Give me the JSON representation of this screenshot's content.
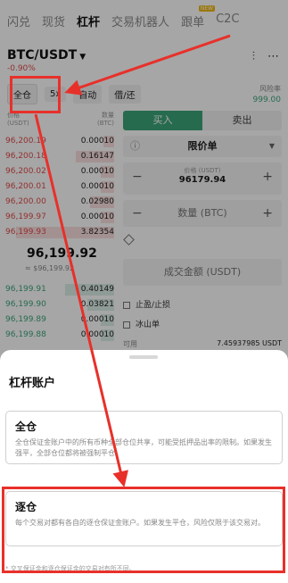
{
  "tabs": [
    {
      "label": "闪兑"
    },
    {
      "label": "现货"
    },
    {
      "label": "杠杆"
    },
    {
      "label": "交易机器人"
    },
    {
      "label": "跟单",
      "badge": "NEW"
    },
    {
      "label": "C2C"
    }
  ],
  "pair": {
    "name": "BTC/USDT",
    "change": "-0.90%"
  },
  "mode": {
    "margin": "全仓",
    "leverage": "5x",
    "auto": "自动",
    "borrow": "借/还"
  },
  "risk": {
    "label": "风险率",
    "value": "999.00"
  },
  "orderbook": {
    "price_header": "价格\n(USDT)",
    "qty_header": "数量\n(BTC)",
    "asks": [
      {
        "price": "96,200.19",
        "qty": "0.00010",
        "depth": 0.1
      },
      {
        "price": "96,200.18",
        "qty": "0.16147",
        "depth": 0.35
      },
      {
        "price": "96,200.02",
        "qty": "0.00010",
        "depth": 0.12
      },
      {
        "price": "96,200.01",
        "qty": "0.00010",
        "depth": 0.12
      },
      {
        "price": "96,200.00",
        "qty": "0.02980",
        "depth": 0.22
      },
      {
        "price": "96,199.97",
        "qty": "0.00010",
        "depth": 0.12
      },
      {
        "price": "96,199.93",
        "qty": "3.82354",
        "depth": 0.9
      }
    ],
    "mid_price": "96,199.92",
    "mid_sub": "≈ $96,199.92",
    "bids": [
      {
        "price": "96,199.91",
        "qty": "0.40149",
        "depth": 0.45
      },
      {
        "price": "96,199.90",
        "qty": "0.03821",
        "depth": 0.25
      },
      {
        "price": "96,199.89",
        "qty": "0.00010",
        "depth": 0.12
      },
      {
        "price": "96,199.88",
        "qty": "0.00010",
        "depth": 0.12
      }
    ]
  },
  "order": {
    "buy": "买入",
    "sell": "卖出",
    "type": "限价单",
    "price_label": "价格 (USDT)",
    "price_value": "96179.94",
    "qty_label": "数量 (BTC)",
    "amount_label": "成交金额 (USDT)",
    "tp_sl": "止盈/止损",
    "iceberg": "冰山单",
    "avail_label": "可用",
    "avail_value": "7.45937985 USDT"
  },
  "sheet": {
    "title": "杠杆账户",
    "cross_title": "全仓",
    "cross_desc": "全仓保证金账户中的所有币种全部仓位共享，可能受抵押品出率的限制。如果发生强平，全部仓位都将被强制平仓。",
    "isolated_title": "逐仓",
    "isolated_desc": "每个交易对都有各自的逐仓保证金账户。如果发生平仓，风险仅限于该交易对。",
    "footnote": "* 交叉保证金和逐仓保证金的交易对有所不同。"
  },
  "colors": {
    "highlight": "#e8302a",
    "buy": "#3ca57a",
    "sell": "#e24b4b"
  }
}
